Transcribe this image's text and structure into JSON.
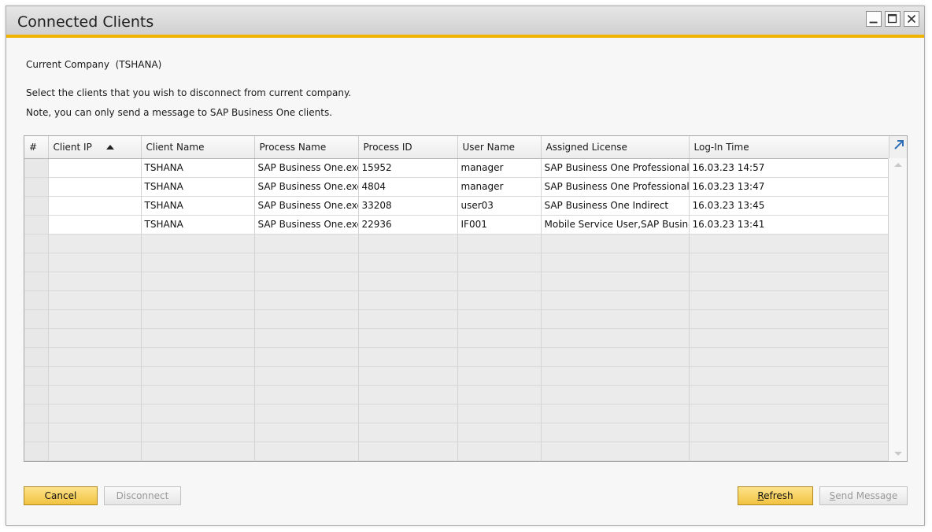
{
  "window": {
    "title": "Connected Clients",
    "icons": [
      "minimize-icon",
      "maximize-icon",
      "close-icon"
    ]
  },
  "info": {
    "current_company_label": "Current Company",
    "current_company_value": "(TSHANA)",
    "instruction": "Select the clients that you wish to disconnect from current company.",
    "note": "Note, you can only send a message to SAP Business One clients."
  },
  "table": {
    "columns": [
      "#",
      "Client IP",
      "Client Name",
      "Process Name",
      "Process ID",
      "User Name",
      "Assigned License",
      "Log-In Time"
    ],
    "rows": [
      {
        "num": "",
        "client_ip": "",
        "client_name": "TSHANA",
        "process_name": "SAP Business One.exe",
        "process_id": "15952",
        "user_name": "manager",
        "license": "SAP Business One Professional",
        "login_time": "16.03.23 14:57"
      },
      {
        "num": "",
        "client_ip": "",
        "client_name": "TSHANA",
        "process_name": "SAP Business One.exe",
        "process_id": "4804",
        "user_name": "manager",
        "license": "SAP Business One Professional",
        "login_time": "16.03.23 13:47"
      },
      {
        "num": "",
        "client_ip": "",
        "client_name": "TSHANA",
        "process_name": "SAP Business One.exe",
        "process_id": "33208",
        "user_name": "user03",
        "license": "SAP Business One Indirect",
        "login_time": "16.03.23 13:45"
      },
      {
        "num": "",
        "client_ip": "",
        "client_name": "TSHANA",
        "process_name": "SAP Business One.exe",
        "process_id": "22936",
        "user_name": "IF001",
        "license": "Mobile Service User,SAP Business",
        "login_time": "16.03.23 13:41"
      }
    ],
    "empty_row_count": 12,
    "sorted_column": "Client IP",
    "sort_direction": "ascending"
  },
  "buttons": {
    "cancel": "Cancel",
    "disconnect": "Disconnect",
    "refresh_first": "R",
    "refresh_rest": "efresh",
    "send_first": "S",
    "send_rest": "end Message"
  },
  "colors": {
    "accent": "#f0b400",
    "primary_button": "#f5cc55",
    "disabled_text": "#9a9a9a"
  }
}
